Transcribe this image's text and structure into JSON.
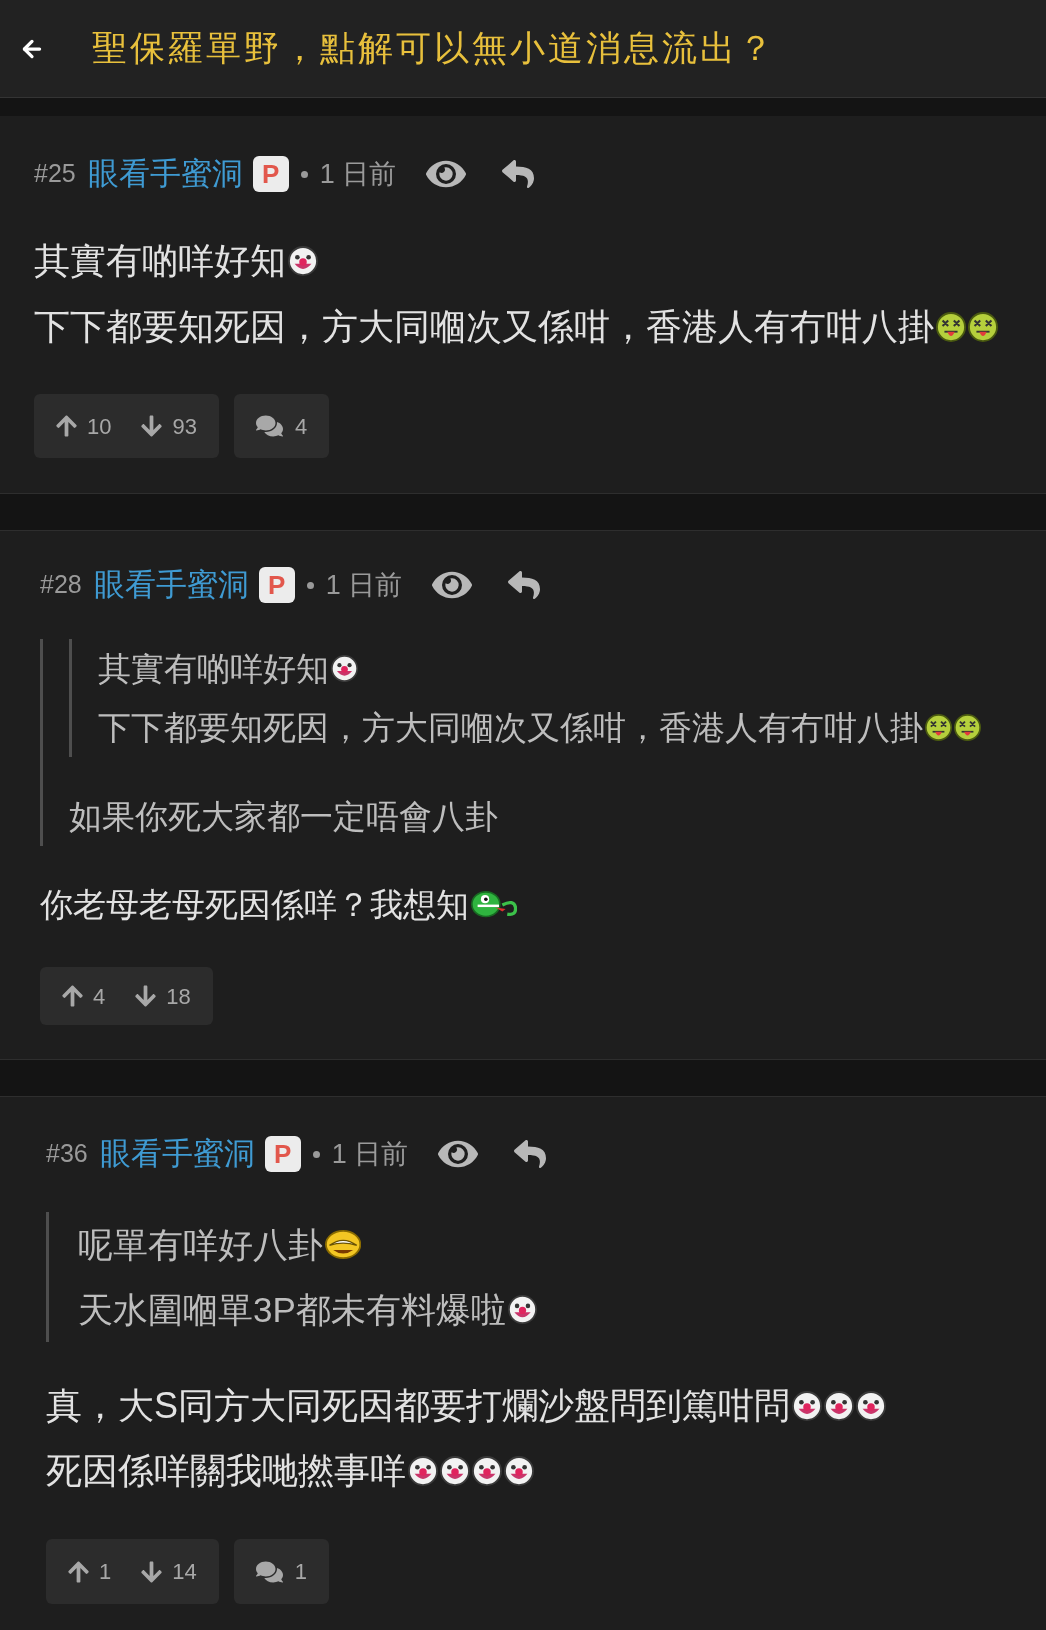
{
  "header": {
    "title": "聖保羅單野，點解可以無小道消息流出？"
  },
  "posts": [
    {
      "number": "#25",
      "author": "眼看手蜜洞",
      "badge": "P",
      "time": "1 日前",
      "lines": [
        {
          "text": "其實有啲咩好知",
          "emojis": [
            {
              "kind": "clown"
            }
          ]
        },
        {
          "text": "下下都要知死因，方大同嗰次又係咁，香港人有冇咁八掛",
          "emojis": [
            {
              "kind": "sick"
            },
            {
              "kind": "sick"
            }
          ]
        }
      ],
      "upvotes": "10",
      "downvotes": "93",
      "comments": "4"
    },
    {
      "number": "#28",
      "author": "眼看手蜜洞",
      "badge": "P",
      "time": "1 日前",
      "quote": {
        "quote": {
          "lines": [
            {
              "text": "其實有啲咩好知",
              "emojis": [
                {
                  "kind": "clown"
                }
              ]
            },
            {
              "text": "下下都要知死因，方大同嗰次又係咁，香港人有冇咁八掛",
              "emojis": [
                {
                  "kind": "sick"
                },
                {
                  "kind": "sick"
                }
              ]
            }
          ]
        },
        "lines": [
          {
            "text": "如果你死大家都一定唔會八卦"
          }
        ]
      },
      "lines": [
        {
          "text": "你老母老母死因係咩？我想知",
          "emojis": [
            {
              "kind": "snake"
            }
          ]
        }
      ],
      "upvotes": "4",
      "downvotes": "18"
    },
    {
      "number": "#36",
      "author": "眼看手蜜洞",
      "badge": "P",
      "time": "1 日前",
      "quote": {
        "lines": [
          {
            "text": "呢單有咩好八卦",
            "emojis": [
              {
                "kind": "laughing"
              }
            ]
          },
          {
            "text": "天水圍嗰單3P都未有料爆啦",
            "emojis": [
              {
                "kind": "clown"
              }
            ]
          }
        ]
      },
      "lines": [
        {
          "text": "真，大S同方大同死因都要打爛沙盤問到篤咁問",
          "emojis": [
            {
              "kind": "clown"
            },
            {
              "kind": "clown"
            },
            {
              "kind": "clown"
            }
          ]
        },
        {
          "text": "死因係咩關我哋撚事咩",
          "emojis": [
            {
              "kind": "clown"
            },
            {
              "kind": "clown"
            },
            {
              "kind": "clown"
            },
            {
              "kind": "clown"
            }
          ]
        }
      ],
      "upvotes": "1",
      "downvotes": "14",
      "comments": "1"
    }
  ]
}
